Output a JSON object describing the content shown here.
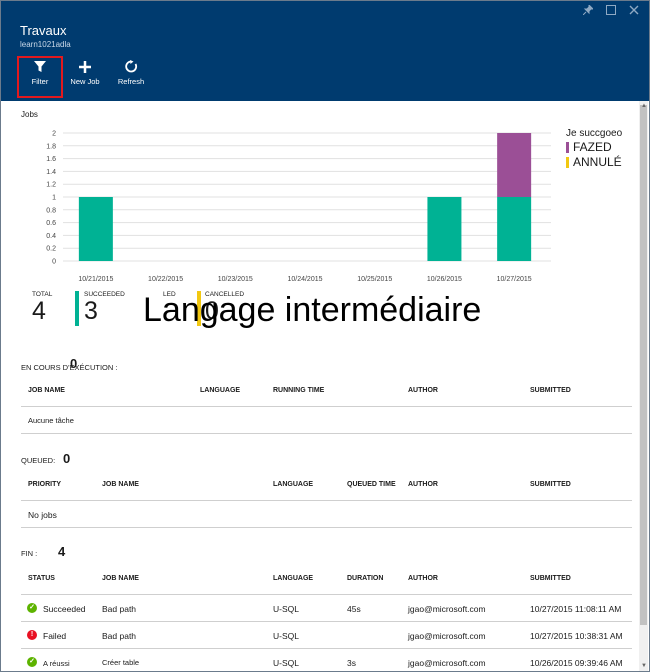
{
  "window": {
    "title": "Travaux",
    "subtitle": "learn1021adla",
    "pin_icon": "pin-icon",
    "maximize_icon": "maximize-icon",
    "close_icon": "close-icon"
  },
  "toolbar": {
    "filter_label": "Filter",
    "new_job_label": "New Job",
    "refresh_label": "Refresh"
  },
  "jobs_section": {
    "label": "Jobs"
  },
  "chart_data": {
    "type": "bar",
    "stacked": true,
    "categories": [
      "10/21/2015",
      "10/22/2015",
      "10/23/2015",
      "10/24/2015",
      "10/25/2015",
      "10/26/2015",
      "10/27/2015"
    ],
    "series": [
      {
        "name": "",
        "color": "#00b294",
        "values": [
          1,
          0,
          0,
          0,
          0,
          1,
          1
        ]
      },
      {
        "name": "FAZED",
        "color": "#9b4f96",
        "values": [
          0,
          0,
          0,
          0,
          0,
          0,
          1
        ]
      }
    ],
    "yticks": [
      "0",
      "0.2",
      "0.4",
      "0.6",
      "0.8",
      "1",
      "1.2",
      "1.4",
      "1.6",
      "1.8",
      "2"
    ],
    "ylim": [
      0,
      2
    ],
    "grid": true,
    "legend": {
      "title": "Je succgoeo",
      "items": [
        {
          "label": "FAZED",
          "color": "#9b4f96"
        },
        {
          "label": "ANNULÉ",
          "color": "#f2c811"
        }
      ],
      "placement": "right"
    }
  },
  "stats": {
    "total_label": "TOTAL",
    "total_value": "4",
    "succeeded_label": "SUCCEEDED",
    "succeeded_value": "3",
    "failed_label": "LED",
    "cancelled_label": "CANCELLED",
    "cancelled_value": "0",
    "succeeded_color": "#00b294",
    "cancelled_color": "#f2c811"
  },
  "overlay_text": "Langage intermédiaire",
  "running": {
    "label": "EN COURS D'EXÉCUTION :",
    "count": "0",
    "columns": [
      "JOB NAME",
      "LANGUAGE",
      "RUNNING TIME",
      "AUTHOR",
      "SUBMITTED"
    ],
    "empty": "Aucune tâche"
  },
  "queued": {
    "label": "QUEUED:",
    "count": "0",
    "columns": [
      "PRIORITY",
      "JOB NAME",
      "LANGUAGE",
      "QUEUED TIME",
      "AUTHOR",
      "SUBMITTED"
    ],
    "empty": "No jobs"
  },
  "finished": {
    "label": "FIN :",
    "count": "4",
    "columns": [
      "STATUS",
      "JOB NAME",
      "LANGUAGE",
      "DURATION",
      "AUTHOR",
      "SUBMITTED"
    ],
    "rows": [
      {
        "status": "Succeeded",
        "status_icon": "check-circle-icon",
        "status_color": "#5db300",
        "name": "Bad path",
        "language": "U-SQL",
        "duration": "45s",
        "author": "jgao@microsoft.com",
        "submitted": "10/27/2015 11:08:11 AM"
      },
      {
        "status": "Failed",
        "status_icon": "error-circle-icon",
        "status_color": "#e81123",
        "name": "Bad path",
        "language": "U-SQL",
        "duration": "",
        "author": "jgao@microsoft.com",
        "submitted": "10/27/2015 10:38:31 AM"
      },
      {
        "status": "A réussi",
        "status_icon": "check-circle-icon",
        "status_color": "#5db300",
        "name": "Créer table",
        "language": "U-SQL",
        "duration": "3s",
        "author": "jgao@microsoft.com",
        "submitted": "10/26/2015 09:39:46 AM"
      }
    ]
  }
}
